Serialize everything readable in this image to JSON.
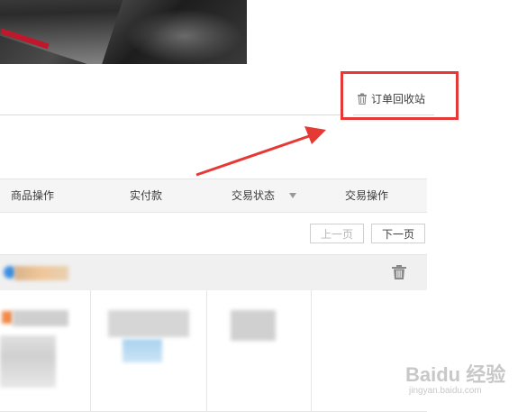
{
  "header": {
    "recycle_bin_label": "订单回收站",
    "recycle_bin_icon": "trash-icon"
  },
  "table": {
    "columns": [
      "商品操作",
      "实付款",
      "交易状态",
      "交易操作"
    ],
    "status_dropdown_icon": "caret-down-icon"
  },
  "pagination": {
    "prev_label": "上一页",
    "next_label": "下一页"
  },
  "order": {
    "delete_icon": "trash-icon"
  },
  "watermark": {
    "brand": "Baidu 经验",
    "domain": "jingyan.baidu.com"
  },
  "colors": {
    "highlight": "#e53935",
    "header_bg": "#f5f5f5"
  }
}
